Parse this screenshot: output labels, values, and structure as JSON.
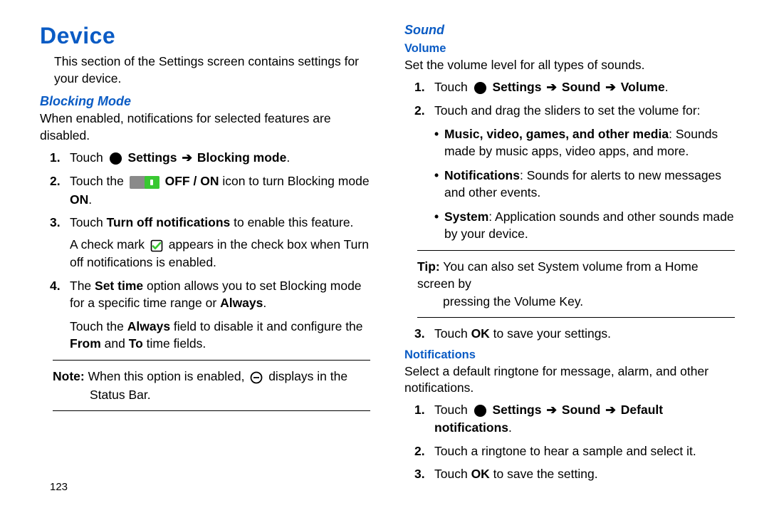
{
  "page_number": "123",
  "left": {
    "h1": "Device",
    "intro": "This section of the Settings screen contains settings for your device.",
    "blocking": {
      "title": "Blocking Mode",
      "desc": "When enabled, notifications for selected features are disabled.",
      "steps": {
        "s1_label": "1.",
        "s1_pre": "Touch ",
        "s1_path_a": "Settings",
        "s1_path_b": "Blocking mode",
        "s2_label": "2.",
        "s2_pre": "Touch the ",
        "s2_mid": " OFF / ON",
        "s2_post": " icon to turn Blocking mode ",
        "s2_on": "ON",
        "s3_label": "3.",
        "s3_pre": "Touch ",
        "s3_bold": "Turn off notifications",
        "s3_post": " to enable this feature.",
        "s3_extra_a": "A check mark ",
        "s3_extra_b": " appears in the check box when Turn off notifications is enabled.",
        "s4_label": "4.",
        "s4_a": "The ",
        "s4_b": "Set time",
        "s4_c": " option allows you to set Blocking mode for a specific time range or ",
        "s4_d": "Always",
        "s4_extra_a": "Touch the ",
        "s4_extra_b": "Always",
        "s4_extra_c": " field to disable it and configure the ",
        "s4_extra_d": "From",
        "s4_extra_e": " and ",
        "s4_extra_f": "To",
        "s4_extra_g": " time fields."
      },
      "note_label": "Note:",
      "note_a": " When this option is enabled, ",
      "note_b": " displays in the",
      "note_c": "Status Bar."
    }
  },
  "right": {
    "sound": {
      "title": "Sound",
      "volume": {
        "title": "Volume",
        "desc": "Set the volume level for all types of sounds.",
        "s1_label": "1.",
        "s1_pre": "Touch ",
        "s1_p1": "Settings",
        "s1_p2": "Sound",
        "s1_p3": "Volume",
        "s2_label": "2.",
        "s2": "Touch and drag the sliders to set the volume for:",
        "b1_bold": "Music, video, games, and other media",
        "b1_rest": ": Sounds made by music apps, video apps, and more.",
        "b2_bold": "Notifications",
        "b2_rest": ": Sounds for alerts to new messages and other events.",
        "b3_bold": "System",
        "b3_rest": ": Application sounds and other sounds made by your device.",
        "tip_label": "Tip:",
        "tip_a": " You can also set System volume from a Home screen by",
        "tip_b": "pressing the Volume Key.",
        "s3_label": "3.",
        "s3_a": "Touch ",
        "s3_b": "OK",
        "s3_c": " to save your settings."
      },
      "notifications": {
        "title": "Notifications",
        "desc": "Select a default ringtone for message, alarm, and other notifications.",
        "s1_label": "1.",
        "s1_pre": "Touch ",
        "s1_p1": "Settings",
        "s1_p2": "Sound",
        "s1_p3": "Default notifications",
        "s2_label": "2.",
        "s2": "Touch a ringtone to hear a sample and select it.",
        "s3_label": "3.",
        "s3_a": "Touch ",
        "s3_b": "OK",
        "s3_c": " to save the setting."
      }
    }
  }
}
